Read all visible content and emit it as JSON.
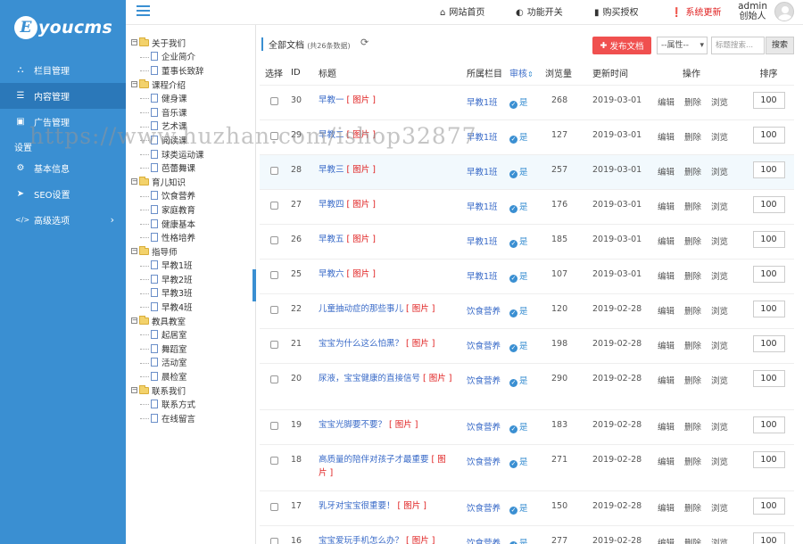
{
  "logo": {
    "badge": "E",
    "text": "youcms"
  },
  "sidebar": {
    "items": [
      {
        "label": "栏目管理",
        "icon": "sitemap-icon",
        "glyph": "⛬"
      },
      {
        "label": "内容管理",
        "icon": "list-icon",
        "glyph": "☰"
      },
      {
        "label": "广告管理",
        "icon": "image-icon",
        "glyph": "▣"
      }
    ],
    "section": "设置",
    "settings": [
      {
        "label": "基本信息",
        "icon": "gear-icon",
        "glyph": "⚙"
      },
      {
        "label": "SEO设置",
        "icon": "paper-plane-icon",
        "glyph": "➤"
      },
      {
        "label": "高级选项",
        "icon": "code-icon",
        "glyph": "</>"
      }
    ]
  },
  "topbar": {
    "home": "网站首页",
    "toggle": "功能开关",
    "buy": "购买授权",
    "update": "系统更新",
    "user_name": "admin",
    "user_role": "创始人"
  },
  "tree": [
    {
      "label": "关于我们",
      "children": [
        "企业简介",
        "董事长致辞"
      ]
    },
    {
      "label": "课程介绍",
      "children": [
        "健身课",
        "音乐课",
        "艺术课",
        "阅读课",
        "球类运动课",
        "芭蕾舞课"
      ]
    },
    {
      "label": "育儿知识",
      "children": [
        "饮食营养",
        "家庭教育",
        "健康基本",
        "性格培养"
      ]
    },
    {
      "label": "指导师",
      "children": [
        "早教1班",
        "早教2班",
        "早教3班",
        "早教4班"
      ]
    },
    {
      "label": "教具教室",
      "children": [
        "起居室",
        "舞蹈室",
        "活动室",
        "晨检室"
      ]
    },
    {
      "label": "联系我们",
      "children": [
        "联系方式",
        "在线留言"
      ]
    }
  ],
  "toolbar": {
    "title": "全部文档",
    "count": "(共26条数据)",
    "add_button": "发布文档",
    "attr_select": "--属性--",
    "search_placeholder": "标题搜索...",
    "search_button": "搜索"
  },
  "table": {
    "headers": {
      "select": "选择",
      "id": "ID",
      "title": "标题",
      "column": "所属栏目",
      "audit": "审核",
      "views": "浏览量",
      "updated": "更新时间",
      "ops": "操作",
      "sort": "排序"
    },
    "img_tag": "[ 图片 ]",
    "yes": "是",
    "ops": {
      "edit": "编辑",
      "delete": "删除",
      "view": "浏览"
    },
    "rows": [
      {
        "id": "30",
        "title": "早教一",
        "column": "早教1班",
        "views": "268",
        "date": "2019-03-01",
        "sort": "100"
      },
      {
        "id": "29",
        "title": "早教二",
        "column": "早教1班",
        "views": "127",
        "date": "2019-03-01",
        "sort": "100"
      },
      {
        "id": "28",
        "title": "早教三",
        "column": "早教1班",
        "views": "257",
        "date": "2019-03-01",
        "sort": "100"
      },
      {
        "id": "27",
        "title": "早教四",
        "column": "早教1班",
        "views": "176",
        "date": "2019-03-01",
        "sort": "100"
      },
      {
        "id": "26",
        "title": "早教五",
        "column": "早教1班",
        "views": "185",
        "date": "2019-03-01",
        "sort": "100"
      },
      {
        "id": "25",
        "title": "早教六",
        "column": "早教1班",
        "views": "107",
        "date": "2019-03-01",
        "sort": "100"
      },
      {
        "id": "22",
        "title": "儿童抽动症的那些事儿",
        "column": "饮食营养",
        "views": "120",
        "date": "2019-02-28",
        "sort": "100"
      },
      {
        "id": "21",
        "title": "宝宝为什么这么怕黑？",
        "column": "饮食营养",
        "views": "198",
        "date": "2019-02-28",
        "sort": "100"
      },
      {
        "id": "20",
        "title": "尿液，宝宝健康的直接信号",
        "column": "饮食营养",
        "views": "290",
        "date": "2019-02-28",
        "sort": "100"
      },
      {
        "id": "19",
        "title": "宝宝光脚要不要？",
        "column": "饮食营养",
        "views": "183",
        "date": "2019-02-28",
        "sort": "100"
      },
      {
        "id": "18",
        "title": "高质量的陪伴对孩子才最重要",
        "column": "饮食营养",
        "views": "271",
        "date": "2019-02-28",
        "sort": "100"
      },
      {
        "id": "17",
        "title": "乳牙对宝宝很重要！",
        "column": "饮食营养",
        "views": "150",
        "date": "2019-02-28",
        "sort": "100"
      },
      {
        "id": "16",
        "title": "宝宝爱玩手机怎么办？",
        "column": "饮食营养",
        "views": "277",
        "date": "2019-02-28",
        "sort": "100"
      }
    ]
  },
  "watermark": "https://www.huzhan.com/ishop32877",
  "colors": {
    "sidebar": "#3a8fd2",
    "active": "#2b78b9",
    "danger": "#f0504f",
    "link": "#3a6bc8"
  }
}
